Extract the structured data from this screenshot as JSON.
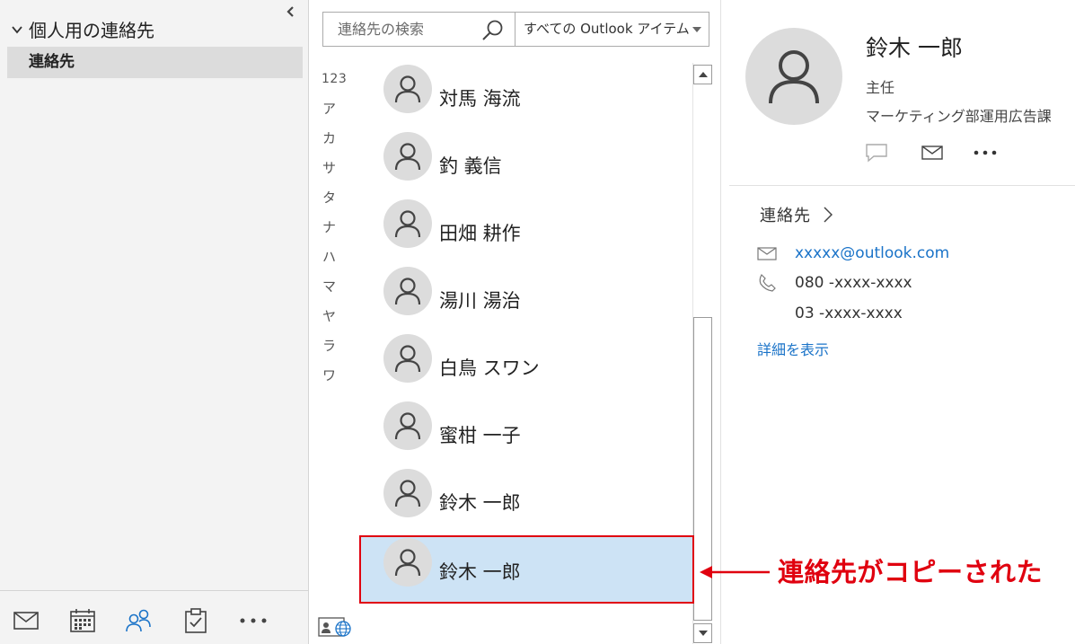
{
  "folder_pane": {
    "group_label": "個人用の連絡先",
    "selected_folder": "連絡先"
  },
  "nav_bar": {
    "icons": [
      "mail-icon",
      "calendar-icon",
      "people-icon",
      "tasks-icon",
      "more-icon"
    ],
    "active": "people-icon"
  },
  "search": {
    "placeholder": "連絡先の検索",
    "scope": "すべての Outlook アイテム"
  },
  "alpha_index": [
    "123",
    "ア",
    "カ",
    "サ",
    "タ",
    "ナ",
    "ハ",
    "マ",
    "ヤ",
    "ラ",
    "ワ"
  ],
  "contacts": [
    {
      "name": "対馬 海流"
    },
    {
      "name": "釣 義信"
    },
    {
      "name": "田畑 耕作"
    },
    {
      "name": "湯川 湯治"
    },
    {
      "name": "白鳥 スワン"
    },
    {
      "name": "蜜柑 一子"
    },
    {
      "name": "鈴木 一郎"
    },
    {
      "name": "鈴木 一郎",
      "selected": true
    }
  ],
  "detail": {
    "name": "鈴木 一郎",
    "title": "主任",
    "department": "マーケティング部運用広告課",
    "section_label": "連絡先",
    "email": "xxxxx@outlook.com",
    "phone_mobile": "080 -xxxx-xxxx",
    "phone_other": "03 -xxxx-xxxx",
    "show_details": "詳細を表示"
  },
  "callout": {
    "text": "連絡先がコピーされた",
    "color": "#e0000f"
  },
  "colors": {
    "accent_blue": "#1a73c8",
    "selection_bg": "#cde3f5",
    "pane_bg": "#f3f3f3"
  }
}
